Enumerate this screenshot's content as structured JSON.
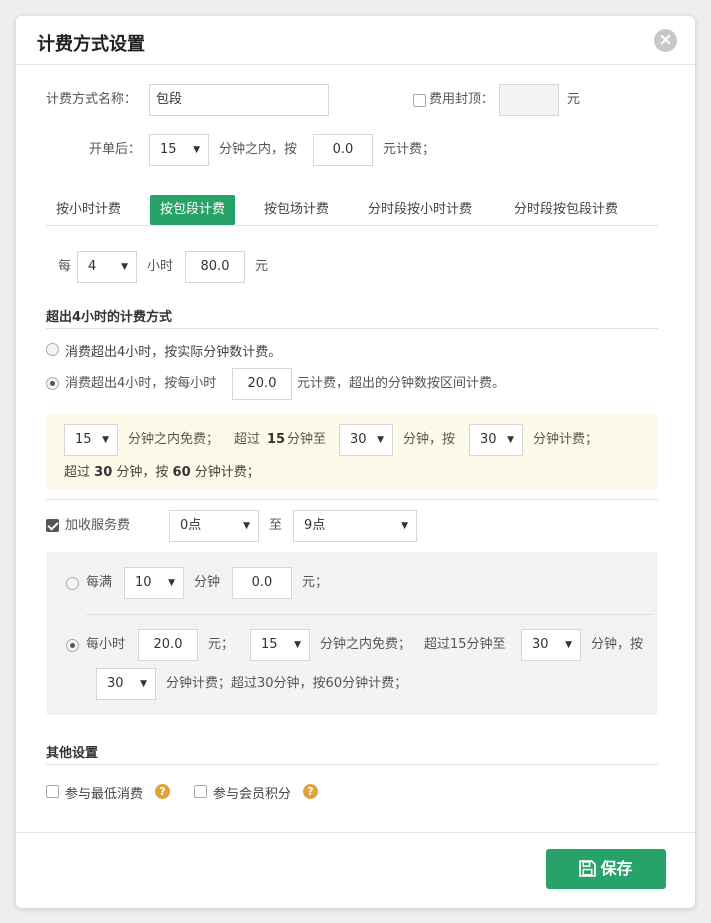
{
  "dialog": {
    "title": "计费方式设置"
  },
  "row1": {
    "name_label": "计费方式名称：",
    "name_value": "包段",
    "cap_label": "费用封顶：",
    "cap_value": "",
    "cap_unit": "元"
  },
  "row2": {
    "label": "开单后：",
    "minutes": "15",
    "within": "分钟之内，按",
    "amount": "0.0",
    "suffix": "元计费；"
  },
  "tabs": [
    "按小时计费",
    "按包段计费",
    "按包场计费",
    "分时段按小时计费",
    "分时段按包段计费"
  ],
  "package": {
    "every": "每",
    "hours": "4",
    "hour_unit": "小时",
    "amount": "80.0",
    "unit": "元"
  },
  "overtime": {
    "title": "超出4小时的计费方式",
    "option1": "消费超出4小时，按实际分钟数计费。",
    "option2_prefix": "消费超出4小时，按每小时",
    "option2_value": "20.0",
    "option2_suffix": "元计费，超出的分钟数按区间计费。"
  },
  "interval": {
    "free_minutes": "15",
    "free_text": "分钟之内免费；",
    "over_text": "超过",
    "over_value": "15",
    "over_to": "分钟至",
    "to_value": "30",
    "to_text": "分钟，按",
    "charge_value": "30",
    "charge_text": "分钟计费；",
    "line2": {
      "prefix": "超过",
      "a": "30",
      "mid": "分钟，按",
      "b": "60",
      "suffix": "分钟计费；"
    }
  },
  "service": {
    "label": "加收服务费",
    "from": "0点",
    "to_text": "至",
    "to": "9点",
    "mode1": {
      "label": "每满",
      "minutes": "10",
      "min_unit": "分钟",
      "amount": "0.0",
      "unit": "元；"
    },
    "mode2": {
      "label": "每小时",
      "amount": "20.0",
      "unit": "元；",
      "free": "15",
      "free_text": "分钟之内免费；",
      "over_text": "超过15分钟至",
      "to": "30",
      "to_text": "分钟，按",
      "charge": "30",
      "tail": "分钟计费；超过30分钟，按60分钟计费；"
    }
  },
  "other": {
    "title": "其他设置",
    "min_consume": "参与最低消费",
    "member_points": "参与会员积分",
    "help_glyph": "?"
  },
  "footer": {
    "save_label": "保存"
  },
  "colors": {
    "accent": "#27a36a",
    "help": "#e0a33a"
  },
  "icons": {
    "close": "close-icon",
    "save": "floppy-disk-icon",
    "help": "question-icon"
  }
}
